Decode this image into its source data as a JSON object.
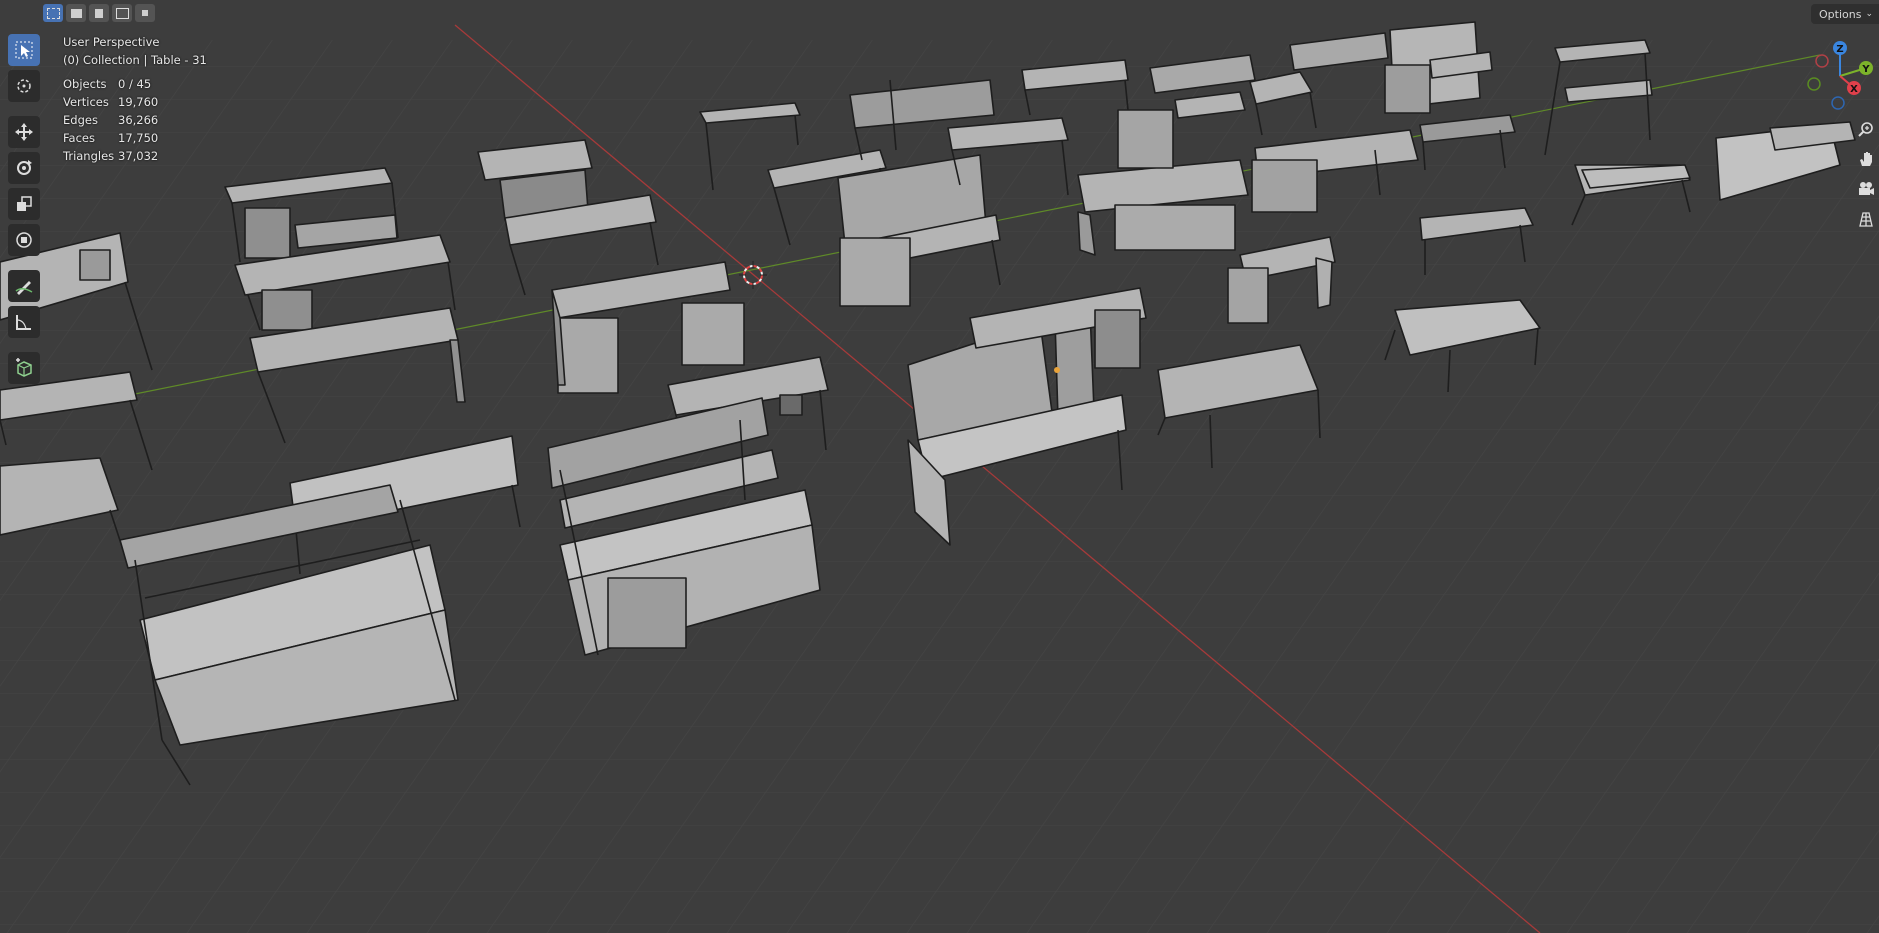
{
  "header": {
    "select_modes": [
      "select-box-new",
      "select-box-extend",
      "select-box-subtract",
      "select-box-invert",
      "select-box-intersect"
    ],
    "options_label": "Options"
  },
  "toolbar": {
    "tools": [
      "select-box-icon",
      "cursor-icon",
      "move-icon",
      "rotate-icon",
      "scale-icon",
      "transform-icon",
      "annotate-icon",
      "measure-icon",
      "add-cube-icon"
    ]
  },
  "viewport": {
    "view_name": "User Perspective",
    "collection_line": "(0) Collection | Table - 31",
    "stats": [
      {
        "label": "Objects",
        "value": "0 / 45"
      },
      {
        "label": "Vertices",
        "value": "19,760"
      },
      {
        "label": "Edges",
        "value": "36,266"
      },
      {
        "label": "Faces",
        "value": "17,750"
      },
      {
        "label": "Triangles",
        "value": "37,032"
      }
    ]
  },
  "gizmo": {
    "x_label": "X",
    "y_label": "Y",
    "z_label": "Z",
    "x_color": "#e0404b",
    "y_color": "#7cb32a",
    "z_color": "#3a86e0"
  },
  "navigation": [
    "zoom-icon",
    "pan-hand-icon",
    "camera-icon",
    "grid-view-icon"
  ],
  "colors": {
    "background": "#3d3d3d",
    "grid": "#4a4a4a",
    "x_axis": "#b33a3a",
    "y_axis": "#6b9c2a",
    "active_tool": "#4772b3",
    "object_face": "#b6b6b6"
  }
}
